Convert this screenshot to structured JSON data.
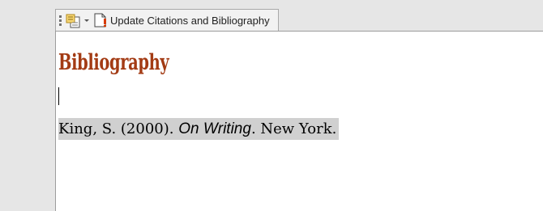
{
  "toolbar": {
    "update_label": "Update Citations and Bibliography",
    "cite_icon": "citation-source-icon",
    "dropdown_icon": "chevron-down-icon",
    "update_icon": "update-document-icon"
  },
  "document": {
    "heading": "Bibliography",
    "entry": {
      "author_year": "King, S. (2000). ",
      "title": "On Writing",
      "rest": ". New York."
    }
  },
  "colors": {
    "heading": "#a33b14",
    "field_shading": "#d0d0d0",
    "toolbar_bg": "#f2f2f2",
    "page_bg": "#ffffff"
  }
}
